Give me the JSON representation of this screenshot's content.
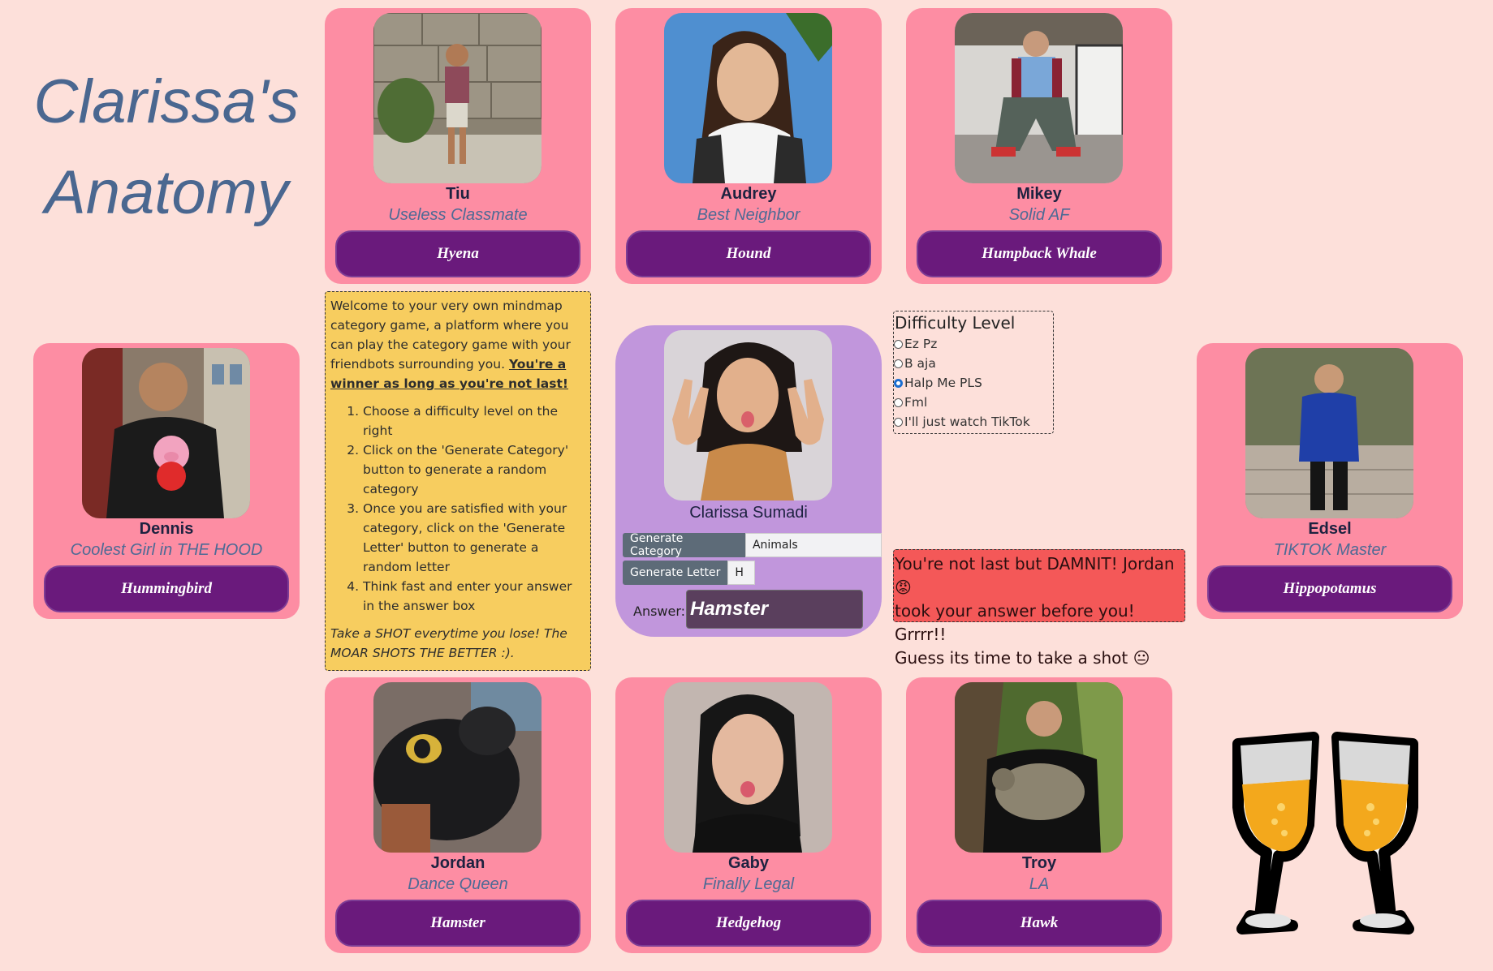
{
  "title": {
    "line1": "Clarissa's",
    "line2": "Anatomy"
  },
  "friends": [
    {
      "name": "Tiu",
      "role": "Useless Classmate",
      "animal": "Hyena"
    },
    {
      "name": "Audrey",
      "role": "Best Neighbor",
      "animal": "Hound"
    },
    {
      "name": "Mikey",
      "role": "Solid AF",
      "animal": "Humpback Whale"
    },
    {
      "name": "Dennis",
      "role": "Coolest Girl in THE HOOD",
      "animal": "Hummingbird"
    },
    {
      "name": "Edsel",
      "role": "TIKTOK Master",
      "animal": "Hippopotamus"
    },
    {
      "name": "Jordan",
      "role": "Dance Queen",
      "animal": "Hamster"
    },
    {
      "name": "Gaby",
      "role": "Finally Legal",
      "animal": "Hedgehog"
    },
    {
      "name": "Troy",
      "role": "LA",
      "animal": "Hawk"
    }
  ],
  "player": {
    "name": "Clarissa Sumadi",
    "generate_category_label": "Generate Category",
    "category": "Animals",
    "generate_letter_label": "Generate Letter",
    "letter": "H",
    "answer_label": "Answer:",
    "answer": "Hamster"
  },
  "instructions": {
    "intro": "Welcome to your very own mindmap category game, a platform where you can play the category game with your friendbots surrounding you.",
    "rule": "You're a winner as long as you're not last!",
    "steps": [
      "Choose a difficulty level on the right",
      "Click on the 'Generate Category' button to generate a random category",
      "Once you are satisfied with your category, click on the 'Generate Letter' button to generate a random letter",
      "Think fast and enter your answer in the answer box"
    ],
    "shot": "Take a SHOT everytime you lose! The MOAR SHOTS THE BETTER :)."
  },
  "difficulty": {
    "heading": "Difficulty Level",
    "options": [
      "Ez Pz",
      "B aja",
      "Halp Me PLS",
      "Fml",
      "I'll just watch TikTok"
    ],
    "selected": "Halp Me PLS"
  },
  "result": {
    "line1": "You're not last but DAMNIT! Jordan 😡",
    "line2": "took your answer before you! Grrrr!!",
    "line3": "Guess its time to take a shot 😐"
  },
  "colors": {
    "background": "#fde0da",
    "card": "#fd8da3",
    "center_card": "#c196dc",
    "button": "#6a1a7c",
    "instructions": "#f7cd5f",
    "alert": "#f45858",
    "title": "#4a6790"
  },
  "icons": {
    "decoration": "clinking-glasses-icon"
  }
}
